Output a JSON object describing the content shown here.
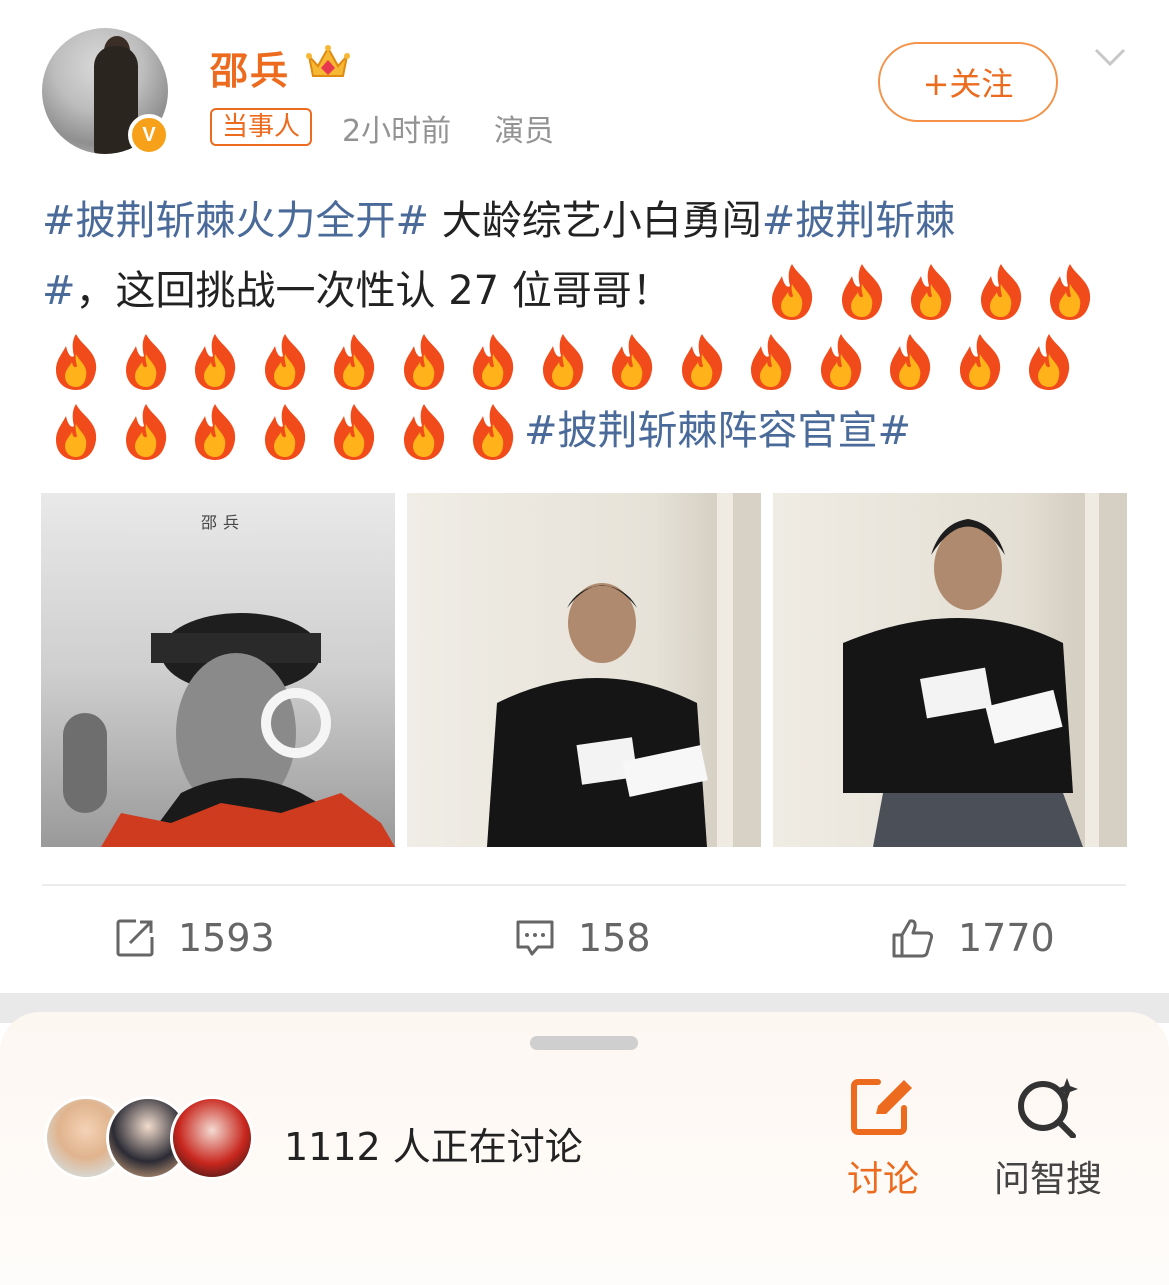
{
  "author": {
    "name": "邵兵",
    "tag": "当事人",
    "time": "2小时前",
    "role": "演员",
    "follow_label": "+关注"
  },
  "post": {
    "line1_topic": "#披荆斩棘火力全开#",
    "line1_text": " 大龄综艺小白勇闯",
    "line1_topic2": "#披荆斩棘",
    "line2_topic_end": "#",
    "line2_text": "，这回挑战一次性认 27 位哥哥！",
    "line3_topic": "#披荆斩棘阵容官宣#",
    "fire_count_line2": 5,
    "fire_count_line3": 15,
    "fire_count_line4": 7
  },
  "photos": {
    "photo1_label": "邵兵"
  },
  "actions": {
    "repost_count": "1593",
    "comment_count": "158",
    "like_count": "1770"
  },
  "discussion": {
    "count_text": "1112 人正在讨论",
    "discuss_label": "讨论",
    "search_label": "问智搜"
  },
  "colors": {
    "accent": "#ec6b1e",
    "topic": "#4a6a9a"
  }
}
